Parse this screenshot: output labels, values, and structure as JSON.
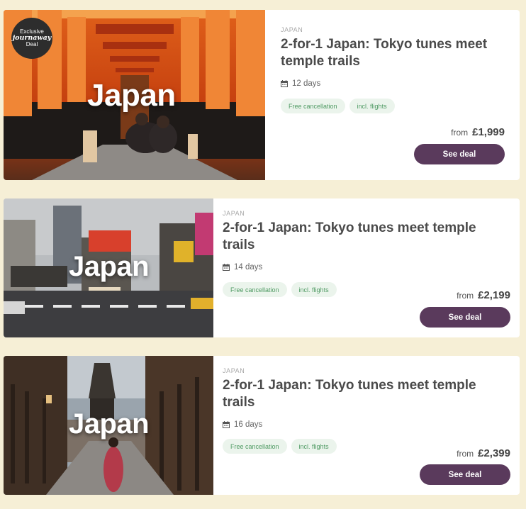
{
  "deals": [
    {
      "image_title": "Japan",
      "badge": {
        "line1": "Exclusive",
        "line2": "journaway",
        "line3": "Deal"
      },
      "country": "JAPAN",
      "title": "2-for-1 Japan: Tokyo tunes meet temple trails",
      "duration": "12 days",
      "tags": [
        "Free cancellation",
        "incl. flights"
      ],
      "price_prefix": "from",
      "price": "£1,999",
      "button_label": "See deal"
    },
    {
      "image_title": "Japan",
      "country": "JAPAN",
      "title": "2-for-1 Japan: Tokyo tunes meet temple trails",
      "duration": "14 days",
      "tags": [
        "Free cancellation",
        "incl. flights"
      ],
      "price_prefix": "from",
      "price": "£2,199",
      "button_label": "See deal"
    },
    {
      "image_title": "Japan",
      "country": "JAPAN",
      "title": "2-for-1 Japan: Tokyo tunes meet temple trails",
      "duration": "16 days",
      "tags": [
        "Free cancellation",
        "incl. flights"
      ],
      "price_prefix": "from",
      "price": "£2,399",
      "button_label": "See deal"
    }
  ],
  "colors": {
    "background": "#f6efd6",
    "button": "#5a3a5c",
    "tag_bg": "#ebf4ec",
    "tag_text": "#4f9a63"
  }
}
